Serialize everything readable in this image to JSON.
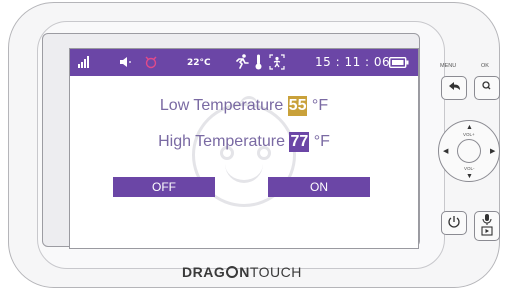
{
  "status_bar": {
    "temperature": "22°C",
    "time": "15 : 11 : 06"
  },
  "settings": {
    "low_label": "Low Temperature",
    "low_value": "55",
    "low_unit": "°F",
    "high_label": "High Temperature",
    "high_value": "77",
    "high_unit": "°F",
    "off_label": "OFF",
    "on_label": "ON"
  },
  "device": {
    "brand_bold": "DRAG",
    "brand_bold2": "N",
    "brand_light": "TOUCH",
    "menu_label": "MENU",
    "ok_label": "OK",
    "vol_up": "VOL+",
    "vol_down": "VOL-"
  },
  "colors": {
    "accent": "#6b46a6",
    "low_value_bg": "#c9a13a",
    "high_value_bg": "#6b46a6",
    "alarm_icon": "#e14a8a"
  }
}
